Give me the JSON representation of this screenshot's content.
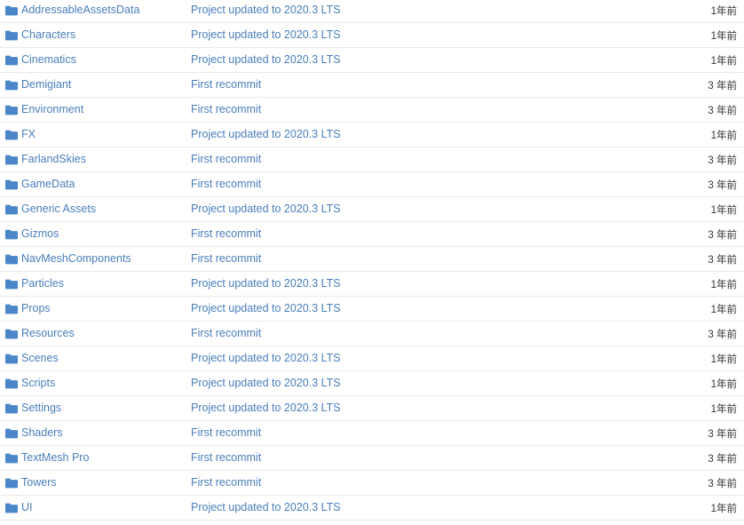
{
  "colors": {
    "link": "#4a7ebb",
    "age_text": "#333333",
    "row_separator": "#e9e9e9",
    "folder_icon": "#4a86c8",
    "background": "#ffffff"
  },
  "file_list": {
    "icon_name": "folder-icon",
    "rows": [
      {
        "name": "AddressableAssetsData",
        "commit": "Project updated to 2020.3 LTS",
        "age": "1年前"
      },
      {
        "name": "Characters",
        "commit": "Project updated to 2020.3 LTS",
        "age": "1年前"
      },
      {
        "name": "Cinematics",
        "commit": "Project updated to 2020.3 LTS",
        "age": "1年前"
      },
      {
        "name": "Demigiant",
        "commit": "First recommit",
        "age": "3 年前"
      },
      {
        "name": "Environment",
        "commit": "First recommit",
        "age": "3 年前"
      },
      {
        "name": "FX",
        "commit": "Project updated to 2020.3 LTS",
        "age": "1年前"
      },
      {
        "name": "FarlandSkies",
        "commit": "First recommit",
        "age": "3 年前"
      },
      {
        "name": "GameData",
        "commit": "First recommit",
        "age": "3 年前"
      },
      {
        "name": "Generic Assets",
        "commit": "Project updated to 2020.3 LTS",
        "age": "1年前"
      },
      {
        "name": "Gizmos",
        "commit": "First recommit",
        "age": "3 年前"
      },
      {
        "name": "NavMeshComponents",
        "commit": "First recommit",
        "age": "3 年前"
      },
      {
        "name": "Particles",
        "commit": "Project updated to 2020.3 LTS",
        "age": "1年前"
      },
      {
        "name": "Props",
        "commit": "Project updated to 2020.3 LTS",
        "age": "1年前"
      },
      {
        "name": "Resources",
        "commit": "First recommit",
        "age": "3 年前"
      },
      {
        "name": "Scenes",
        "commit": "Project updated to 2020.3 LTS",
        "age": "1年前"
      },
      {
        "name": "Scripts",
        "commit": "Project updated to 2020.3 LTS",
        "age": "1年前"
      },
      {
        "name": "Settings",
        "commit": "Project updated to 2020.3 LTS",
        "age": "1年前"
      },
      {
        "name": "Shaders",
        "commit": "First recommit",
        "age": "3 年前"
      },
      {
        "name": "TextMesh Pro",
        "commit": "First recommit",
        "age": "3 年前"
      },
      {
        "name": "Towers",
        "commit": "First recommit",
        "age": "3 年前"
      },
      {
        "name": "UI",
        "commit": "Project updated to 2020.3 LTS",
        "age": "1年前"
      }
    ]
  }
}
